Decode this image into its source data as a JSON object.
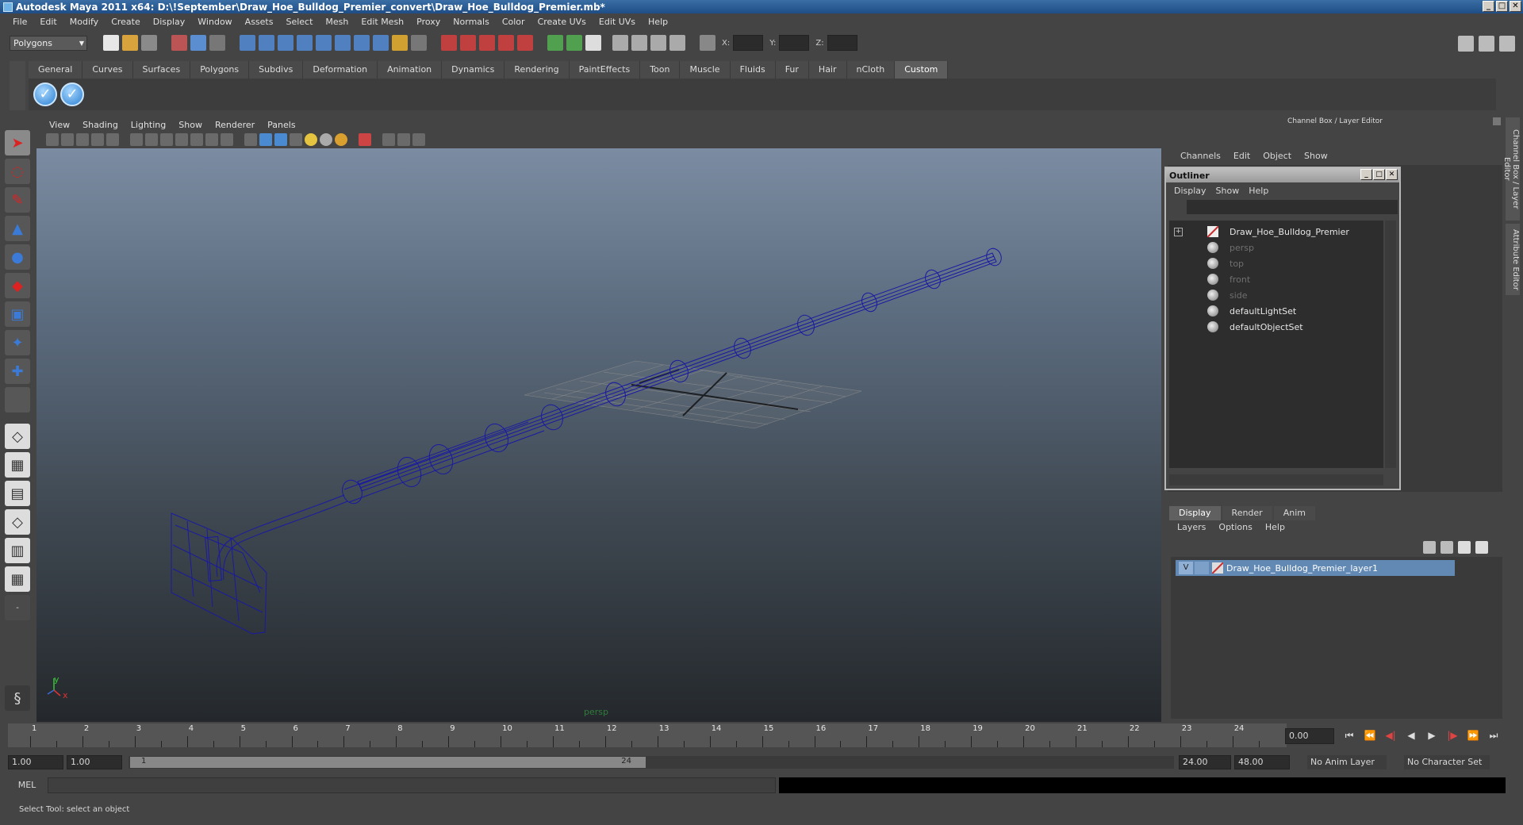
{
  "title": "Autodesk Maya 2011 x64: D:\\!September\\Draw_Hoe_Bulldog_Premier_convert\\Draw_Hoe_Bulldog_Premier.mb*",
  "menubar": [
    "File",
    "Edit",
    "Modify",
    "Create",
    "Display",
    "Window",
    "Assets",
    "Select",
    "Mesh",
    "Edit Mesh",
    "Proxy",
    "Normals",
    "Color",
    "Create UVs",
    "Edit UVs",
    "Help"
  ],
  "statusline": {
    "mode": "Polygons",
    "x_label": "X:",
    "y_label": "Y:",
    "z_label": "Z:"
  },
  "shelf_tabs": [
    "General",
    "Curves",
    "Surfaces",
    "Polygons",
    "Subdivs",
    "Deformation",
    "Animation",
    "Dynamics",
    "Rendering",
    "PaintEffects",
    "Toon",
    "Muscle",
    "Fluids",
    "Fur",
    "Hair",
    "nCloth",
    "Custom"
  ],
  "shelf_active": "Custom",
  "viewport": {
    "menu": [
      "View",
      "Shading",
      "Lighting",
      "Show",
      "Renderer",
      "Panels"
    ],
    "camera_label": "persp",
    "axis_x": "x",
    "axis_y": "y"
  },
  "right_panel": {
    "header": "Channel Box / Layer Editor",
    "menu": [
      "Channels",
      "Edit",
      "Object",
      "Show"
    ],
    "side_tabs": [
      "Channel Box / Layer Editor",
      "Attribute Editor"
    ]
  },
  "outliner": {
    "title": "Outliner",
    "menu": [
      "Display",
      "Show",
      "Help"
    ],
    "items": [
      {
        "label": "Draw_Hoe_Bulldog_Premier",
        "icon": "mesh-icon"
      },
      {
        "label": "persp",
        "icon": "camera-icon"
      },
      {
        "label": "top",
        "icon": "camera-icon"
      },
      {
        "label": "front",
        "icon": "camera-icon"
      },
      {
        "label": "side",
        "icon": "camera-icon"
      },
      {
        "label": "defaultLightSet",
        "icon": "set-icon"
      },
      {
        "label": "defaultObjectSet",
        "icon": "set-icon"
      }
    ]
  },
  "layer_editor": {
    "tabs": [
      "Display",
      "Render",
      "Anim"
    ],
    "menu": [
      "Layers",
      "Options",
      "Help"
    ],
    "layer": {
      "visible": "V",
      "name": "Draw_Hoe_Bulldog_Premier_layer1"
    }
  },
  "timeline": {
    "ticks": [
      "1",
      "2",
      "3",
      "4",
      "5",
      "6",
      "7",
      "8",
      "9",
      "10",
      "11",
      "12",
      "13",
      "14",
      "15",
      "16",
      "17",
      "18",
      "19",
      "20",
      "21",
      "22",
      "23",
      "24"
    ],
    "current_frame": "0.00"
  },
  "range": {
    "start": "1.00",
    "playback_start": "1.00",
    "thumb_start": "1",
    "thumb_end": "24",
    "playback_end": "24.00",
    "end": "48.00",
    "anim_layer": "No Anim Layer",
    "character_set": "No Character Set"
  },
  "command": {
    "label": "MEL"
  },
  "help_line": "Select Tool: select an object",
  "colors": {
    "wire": "#1a1aa0",
    "grid": "#9a9a9a",
    "layer_highlight": "#6189b4"
  }
}
